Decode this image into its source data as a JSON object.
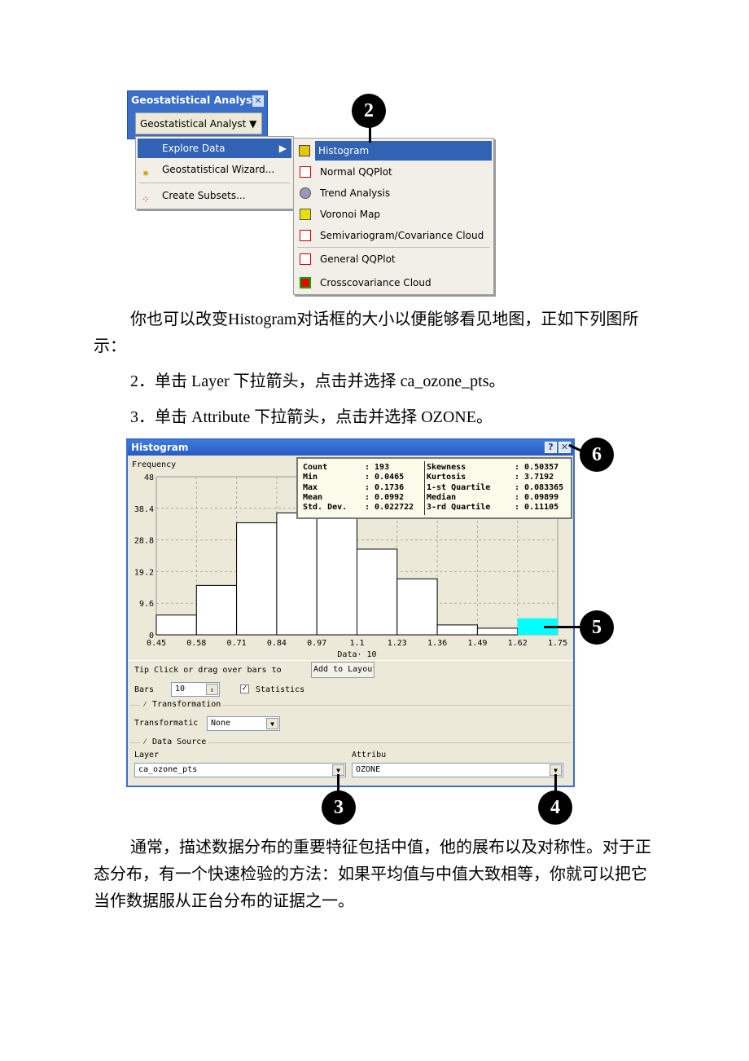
{
  "menu_screenshot": {
    "toolbar_title": "Geostatistical Analyst",
    "toolbar_dropdown": "Geostatistical Analyst",
    "menu_items": [
      "Explore Data",
      "Geostatistical Wizard...",
      "Create Subsets..."
    ],
    "submenu_items": [
      "Histogram",
      "Normal QQPlot",
      "Trend Analysis",
      "Voronoi Map",
      "Semivariogram/Covariance Cloud",
      "General QQPlot",
      "Crosscovariance Cloud"
    ],
    "callout": "2",
    "highlight_color": "#3162b4"
  },
  "paragraphs": {
    "p1": "你也可以改变Histogram对话框的大小以便能够看见地图，正如下列图所示：",
    "p2": "2．单击 Layer 下拉箭头，点击并选择 ca_ozone_pts。",
    "p3": "3．单击 Attribute 下拉箭头，点击并选择 OZONE。",
    "p4": "通常，描述数据分布的重要特征包括中值，他的展布以及对称性。对于正态分布，有一个快速检验的方法：如果平均值与中值大致相等，你就可以把它当作数据服从正台分布的证据之一。"
  },
  "dialog": {
    "title": "Histogram",
    "help": "?",
    "close": "✕",
    "stats": {
      "left": [
        [
          "Count",
          ": 193"
        ],
        [
          "Min",
          ": 0.0465"
        ],
        [
          "Max",
          ": 0.1736"
        ],
        [
          "Mean",
          ": 0.0992"
        ],
        [
          "Std. Dev.",
          ": 0.022722"
        ]
      ],
      "right": [
        [
          "Skewness",
          ": 0.50357"
        ],
        [
          "Kurtosis",
          ": 3.7192"
        ],
        [
          "1-st Quartile",
          ": 0.083365"
        ],
        [
          "Median",
          ": 0.09899"
        ],
        [
          "3-rd Quartile",
          ": 0.11105"
        ]
      ]
    },
    "tip": "Tip  Click or drag over bars to",
    "add_to_layout": "Add to Layout",
    "bars_label": "Bars",
    "bars_value": "10",
    "statistics_label": "Statistics",
    "statistics_checked": true,
    "transformation_group": "Transformation",
    "transformation_label": "Transformatic",
    "transformation_value": "None",
    "datasource_group": "Data Source",
    "layer_label": "Layer",
    "layer_value": "ca_ozone_pts",
    "attribute_label": "Attribu",
    "attribute_value": "OZONE",
    "callouts": [
      "3",
      "4",
      "5",
      "6"
    ]
  },
  "chart_data": {
    "type": "bar",
    "ylabel": "Frequency",
    "xlabel": "Data· 10",
    "x_ticks": [
      "0.45",
      "0.58",
      "0.71",
      "0.84",
      "0.97",
      "1.1",
      "1.23",
      "1.36",
      "1.49",
      "1.62",
      "1.75"
    ],
    "y_ticks": [
      "0",
      "9.6",
      "19.2",
      "28.8",
      "38.4",
      "48"
    ],
    "ylim": [
      0,
      48
    ],
    "bin_edges": [
      0.45,
      0.58,
      0.71,
      0.84,
      0.97,
      1.1,
      1.23,
      1.36,
      1.49,
      1.62,
      1.75
    ],
    "values": [
      6,
      15,
      34,
      37,
      48,
      26,
      17,
      3,
      2,
      5
    ],
    "selected_bin": 9,
    "selected_color": "#00ffff",
    "grid": true
  }
}
